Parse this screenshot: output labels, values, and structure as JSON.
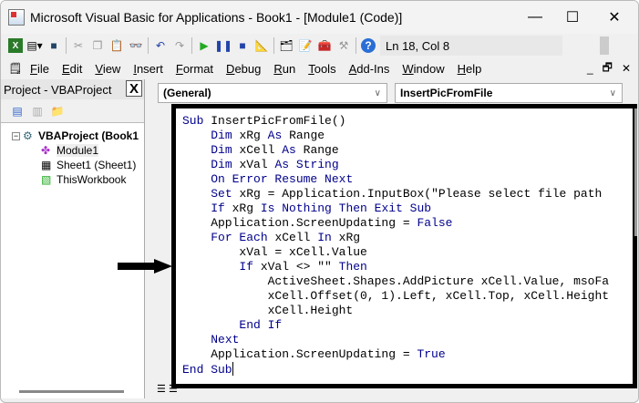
{
  "window": {
    "title": "Microsoft Visual Basic for Applications - Book1 - [Module1 (Code)]",
    "minimize": "—",
    "maximize": "☐",
    "close": "✕"
  },
  "toolbar": {
    "status": "Ln 18, Col 8"
  },
  "menubar": {
    "items": [
      "File",
      "Edit",
      "View",
      "Insert",
      "Format",
      "Debug",
      "Run",
      "Tools",
      "Add-Ins",
      "Window",
      "Help"
    ],
    "mdi": [
      "_",
      "🗗",
      "✕"
    ]
  },
  "project": {
    "title": "Project - VBAProject",
    "close": "X",
    "root": "VBAProject (Book1",
    "items": [
      "Module1",
      "Sheet1 (Sheet1)",
      "ThisWorkbook"
    ]
  },
  "combos": {
    "object": "(General)",
    "procedure": "InsertPicFromFile"
  },
  "code": {
    "lines": [
      [
        [
          "k",
          "Sub "
        ],
        [
          "t",
          "InsertPicFromFile()"
        ]
      ],
      [
        [
          "t",
          "    "
        ],
        [
          "k",
          "Dim "
        ],
        [
          "t",
          "xRg "
        ],
        [
          "k",
          "As "
        ],
        [
          "t",
          "Range"
        ]
      ],
      [
        [
          "t",
          "    "
        ],
        [
          "k",
          "Dim "
        ],
        [
          "t",
          "xCell "
        ],
        [
          "k",
          "As "
        ],
        [
          "t",
          "Range"
        ]
      ],
      [
        [
          "t",
          "    "
        ],
        [
          "k",
          "Dim "
        ],
        [
          "t",
          "xVal "
        ],
        [
          "k",
          "As String"
        ]
      ],
      [
        [
          "t",
          "    "
        ],
        [
          "k",
          "On Error Resume Next"
        ]
      ],
      [
        [
          "t",
          "    "
        ],
        [
          "k",
          "Set "
        ],
        [
          "t",
          "xRg = Application.InputBox(\"Please select file path"
        ]
      ],
      [
        [
          "t",
          "    "
        ],
        [
          "k",
          "If "
        ],
        [
          "t",
          "xRg "
        ],
        [
          "k",
          "Is Nothing Then Exit Sub"
        ]
      ],
      [
        [
          "t",
          "    Application.ScreenUpdating = "
        ],
        [
          "k",
          "False"
        ]
      ],
      [
        [
          "t",
          "    "
        ],
        [
          "k",
          "For Each "
        ],
        [
          "t",
          "xCell "
        ],
        [
          "k",
          "In "
        ],
        [
          "t",
          "xRg"
        ]
      ],
      [
        [
          "t",
          "        xVal = xCell.Value"
        ]
      ],
      [
        [
          "t",
          "        "
        ],
        [
          "k",
          "If "
        ],
        [
          "t",
          "xVal <> \"\" "
        ],
        [
          "k",
          "Then"
        ]
      ],
      [
        [
          "t",
          "            ActiveSheet.Shapes.AddPicture xCell.Value, msoFa"
        ]
      ],
      [
        [
          "t",
          "            xCell.Offset(0, 1).Left, xCell.Top, xCell.Height"
        ]
      ],
      [
        [
          "t",
          "            xCell.Height"
        ]
      ],
      [
        [
          "t",
          "        "
        ],
        [
          "k",
          "End If"
        ]
      ],
      [
        [
          "t",
          "    "
        ],
        [
          "k",
          "Next"
        ]
      ],
      [
        [
          "t",
          "    Application.ScreenUpdating = "
        ],
        [
          "k",
          "True"
        ]
      ],
      [
        [
          "k",
          "End Sub"
        ]
      ]
    ]
  }
}
